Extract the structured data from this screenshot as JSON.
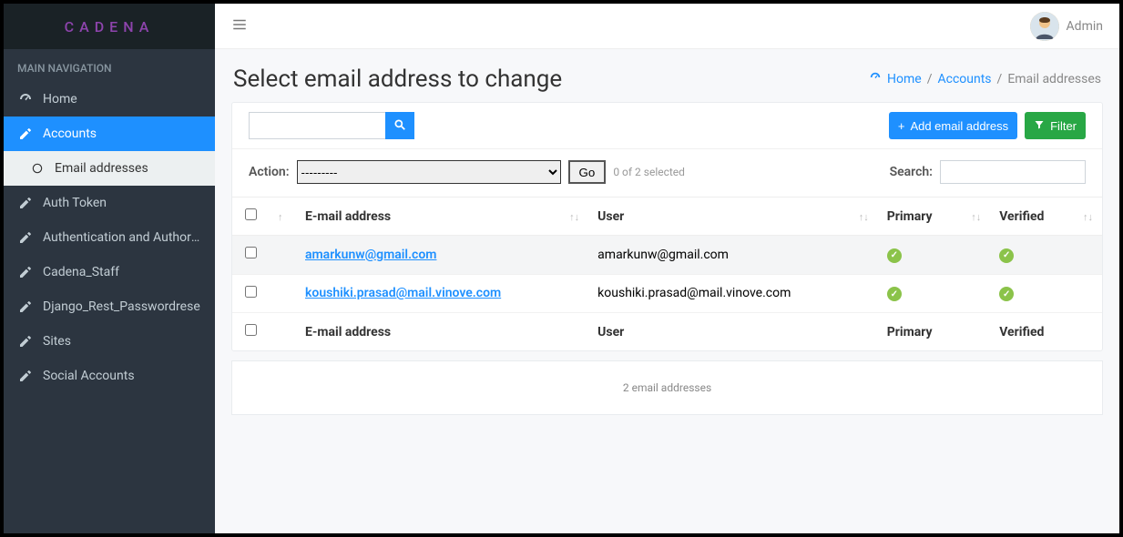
{
  "brand": "CADENA",
  "nav_header": "MAIN NAVIGATION",
  "sidebar": {
    "items": [
      {
        "label": "Home"
      },
      {
        "label": "Accounts"
      },
      {
        "label": "Email addresses"
      },
      {
        "label": "Auth Token"
      },
      {
        "label": "Authentication and Authoriza"
      },
      {
        "label": "Cadena_Staff"
      },
      {
        "label": "Django_Rest_Passwordrese"
      },
      {
        "label": "Sites"
      },
      {
        "label": "Social Accounts"
      }
    ]
  },
  "user": {
    "name": "Admin"
  },
  "page_title": "Select email address to change",
  "breadcrumb": {
    "home": "Home",
    "accounts": "Accounts",
    "current": "Email addresses",
    "sep": "/"
  },
  "toolbar": {
    "add_label": "Add email address",
    "filter_label": "Filter"
  },
  "action": {
    "label": "Action:",
    "placeholder": "---------",
    "go": "Go",
    "selected": "0 of 2 selected",
    "search_label": "Search:"
  },
  "table": {
    "headers": {
      "email": "E-mail address",
      "user": "User",
      "primary": "Primary",
      "verified": "Verified"
    },
    "rows": [
      {
        "email": "amarkunw@gmail.com",
        "user": "amarkunw@gmail.com",
        "primary": true,
        "verified": true
      },
      {
        "email": "koushiki.prasad@mail.vinove.com",
        "user": "koushiki.prasad@mail.vinove.com",
        "primary": true,
        "verified": true
      }
    ],
    "footer": {
      "email": "E-mail address",
      "user": "User",
      "primary": "Primary",
      "verified": "Verified"
    }
  },
  "footer_count": "2 email addresses"
}
